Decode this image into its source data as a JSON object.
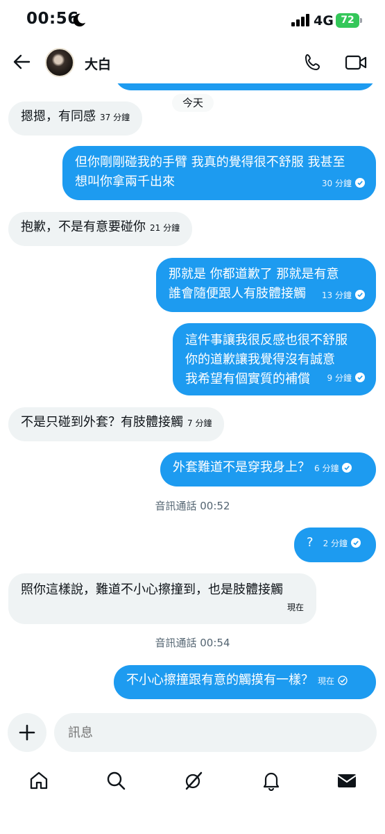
{
  "status_bar": {
    "time": "00:56",
    "network": "4G",
    "battery": "72"
  },
  "header": {
    "contact_name": "大白"
  },
  "date_divider": "今天",
  "messages": [
    {
      "dir": "in",
      "text": "摁摁，有同感",
      "time": "37 分鐘"
    },
    {
      "dir": "out",
      "lines": [
        "但你剛剛碰我的手臂 我真的覺得很不舒服 我甚至",
        "想叫你拿兩千出來"
      ],
      "time": "30 分鐘"
    },
    {
      "dir": "in",
      "text": "抱歉，不是有意要碰你",
      "time": "21 分鐘"
    },
    {
      "dir": "out",
      "lines": [
        "那就是 你都道歉了 那就是有意",
        "誰會隨便跟人有肢體接觸"
      ],
      "time": "13 分鐘"
    },
    {
      "dir": "out",
      "lines": [
        "這件事讓我很反感也很不舒服",
        "你的道歉讓我覺得沒有誠意",
        "我希望有個實質的補償"
      ],
      "time": "9 分鐘"
    },
    {
      "dir": "in",
      "text": "不是只碰到外套？有肢體接觸",
      "time": "7 分鐘"
    },
    {
      "dir": "out",
      "text": "外套難道不是穿我身上？",
      "time": "6 分鐘"
    },
    {
      "dir": "out",
      "text": "?",
      "time": "2 分鐘"
    },
    {
      "dir": "in",
      "text": "照你這樣說，難道不小心擦撞到，也是肢體接觸",
      "time": "現在"
    },
    {
      "dir": "out",
      "text": "不小心擦撞跟有意的觸摸有一樣？",
      "time": "現在"
    }
  ],
  "system_events": [
    "音訊通話 00:52",
    "音訊通話 00:54"
  ],
  "composer": {
    "placeholder": "訊息"
  },
  "nav": {
    "items": [
      "home-icon",
      "search-icon",
      "grok-icon",
      "bell-icon",
      "mail-icon"
    ]
  },
  "colors": {
    "accent": "#1d9bf0",
    "incoming_bubble": "#eff3f4",
    "battery": "#34c759"
  }
}
